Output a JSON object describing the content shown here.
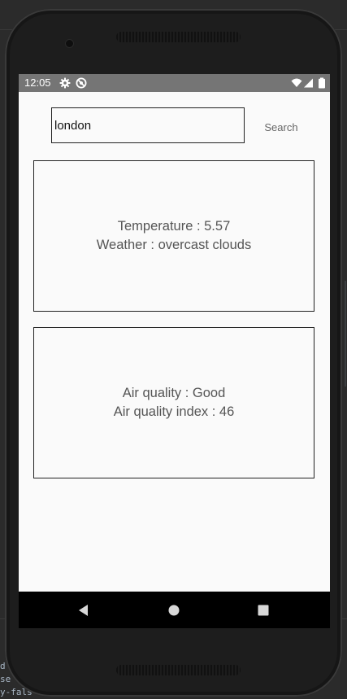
{
  "ide_background": {
    "lines": [
      "d",
      "se",
      "y-fals"
    ]
  },
  "status_bar": {
    "time": "12:05",
    "left_icons": [
      "settings-gear-icon",
      "do-not-disturb-icon"
    ],
    "right_icons": [
      "wifi-icon",
      "cellular-signal-icon",
      "battery-icon"
    ]
  },
  "search": {
    "input_value": "london",
    "button_label": "Search"
  },
  "weather_card": {
    "temperature_line": "Temperature : 5.57",
    "weather_line": "Weather : overcast clouds"
  },
  "air_card": {
    "quality_line": "Air quality : Good",
    "index_line": "Air quality index : 46"
  },
  "nav_bar": {
    "buttons": [
      "back-icon",
      "home-icon",
      "recents-icon"
    ]
  },
  "colors": {
    "status_bar": "#757575",
    "screen_background": "#fafafa",
    "nav_bar": "#000000",
    "text_gray": "#555555"
  }
}
